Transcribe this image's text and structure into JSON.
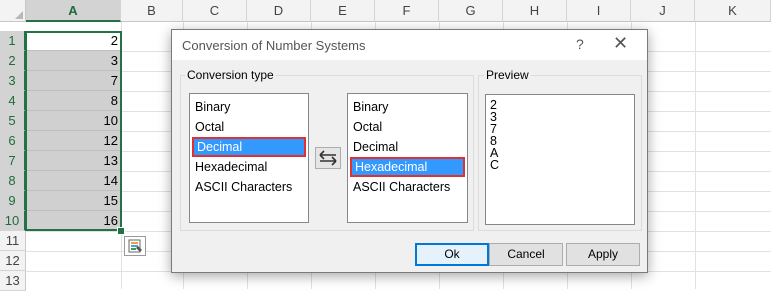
{
  "spreadsheet": {
    "columns": [
      "A",
      "B",
      "C",
      "D",
      "E",
      "F",
      "G",
      "H",
      "I",
      "J",
      "K"
    ],
    "rows": [
      "1",
      "2",
      "3",
      "4",
      "5",
      "6",
      "7",
      "8",
      "9",
      "10",
      "11",
      "12",
      "13"
    ],
    "cells_A": [
      "2",
      "3",
      "7",
      "8",
      "10",
      "12",
      "13",
      "14",
      "15",
      "16"
    ]
  },
  "dialog": {
    "title": "Conversion of Number Systems",
    "help_icon": "question-mark-icon",
    "close_icon": "close-icon",
    "conversion_type_label": "Conversion type",
    "from_list": [
      "Binary",
      "Octal",
      "Decimal",
      "Hexadecimal",
      "ASCII Characters"
    ],
    "from_selected": "Decimal",
    "to_list": [
      "Binary",
      "Octal",
      "Decimal",
      "Hexadecimal",
      "ASCII Characters"
    ],
    "to_selected": "Hexadecimal",
    "swap_icon": "swap-arrows-icon",
    "preview_label": "Preview",
    "preview_values": [
      "2",
      "3",
      "7",
      "8",
      "A",
      "C"
    ],
    "buttons": {
      "ok": "Ok",
      "cancel": "Cancel",
      "apply": "Apply"
    }
  },
  "colors": {
    "selection": "#3399ff",
    "highlight_border": "#e03030",
    "excel_green": "#217346"
  }
}
